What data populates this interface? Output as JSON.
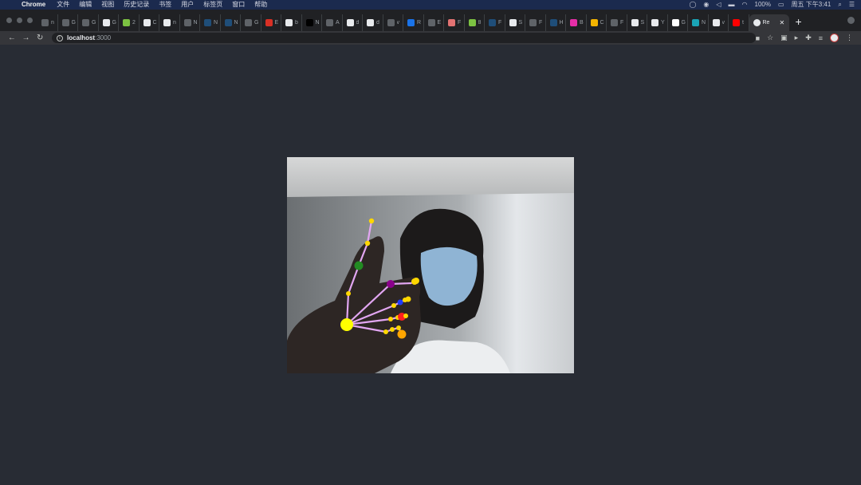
{
  "menubar": {
    "app_name": "Chrome",
    "items": [
      "文件",
      "编辑",
      "视图",
      "历史记录",
      "书签",
      "用户",
      "标签页",
      "窗口",
      "帮助"
    ],
    "battery": "100%",
    "clock": "周五 下午3:41"
  },
  "browser": {
    "tabs": [
      {
        "label": "n",
        "color": "#5f6368"
      },
      {
        "label": "G",
        "color": "#5f6368"
      },
      {
        "label": "G",
        "color": "#5f6368"
      },
      {
        "label": "G",
        "color": "#e8eaed"
      },
      {
        "label": "2",
        "color": "#7cc242"
      },
      {
        "label": "C",
        "color": "#e8eaed"
      },
      {
        "label": "n",
        "color": "#e8eaed"
      },
      {
        "label": "N",
        "color": "#5f6368"
      },
      {
        "label": "N",
        "color": "#1f4e79"
      },
      {
        "label": "N",
        "color": "#1f4e79"
      },
      {
        "label": "G",
        "color": "#5f6368"
      },
      {
        "label": "E",
        "color": "#d93025"
      },
      {
        "label": "b",
        "color": "#e8eaed"
      },
      {
        "label": "N",
        "color": "#000000"
      },
      {
        "label": "A",
        "color": "#5f6368"
      },
      {
        "label": "d",
        "color": "#e8eaed"
      },
      {
        "label": "d",
        "color": "#e8eaed"
      },
      {
        "label": "v",
        "color": "#5f6368"
      },
      {
        "label": "R",
        "color": "#1a73e8"
      },
      {
        "label": "E",
        "color": "#5f6368"
      },
      {
        "label": "F",
        "color": "#e37373"
      },
      {
        "label": "8",
        "color": "#7cc242"
      },
      {
        "label": "F",
        "color": "#1f4e79"
      },
      {
        "label": "S",
        "color": "#e8eaed"
      },
      {
        "label": "F",
        "color": "#5f6368"
      },
      {
        "label": "H",
        "color": "#1f4e79"
      },
      {
        "label": "B",
        "color": "#e62ea8"
      },
      {
        "label": "C",
        "color": "#f4b400"
      },
      {
        "label": "F",
        "color": "#5f6368"
      },
      {
        "label": "S",
        "color": "#e8eaed"
      },
      {
        "label": "Y",
        "color": "#e8eaed"
      },
      {
        "label": "G",
        "color": "#ffffff"
      },
      {
        "label": "N",
        "color": "#1aa3b5"
      },
      {
        "label": "v",
        "color": "#e8eaed"
      },
      {
        "label": "t",
        "color": "#ff0000"
      }
    ],
    "active_tab": {
      "label": "Re",
      "close": "✕"
    },
    "new_tab": "+",
    "url_host": "localhost",
    "url_port": ":3000"
  },
  "hand_overlay": {
    "joint_color": "#ffd700",
    "bone_color": "#e2a6f2",
    "highlight_colors": {
      "wrist": "#ffff00",
      "thumb": "#228b22",
      "index": "#8b008b",
      "middle": "#1e3cff",
      "ring": "#ff2020",
      "pinky": "#ffa500"
    }
  }
}
